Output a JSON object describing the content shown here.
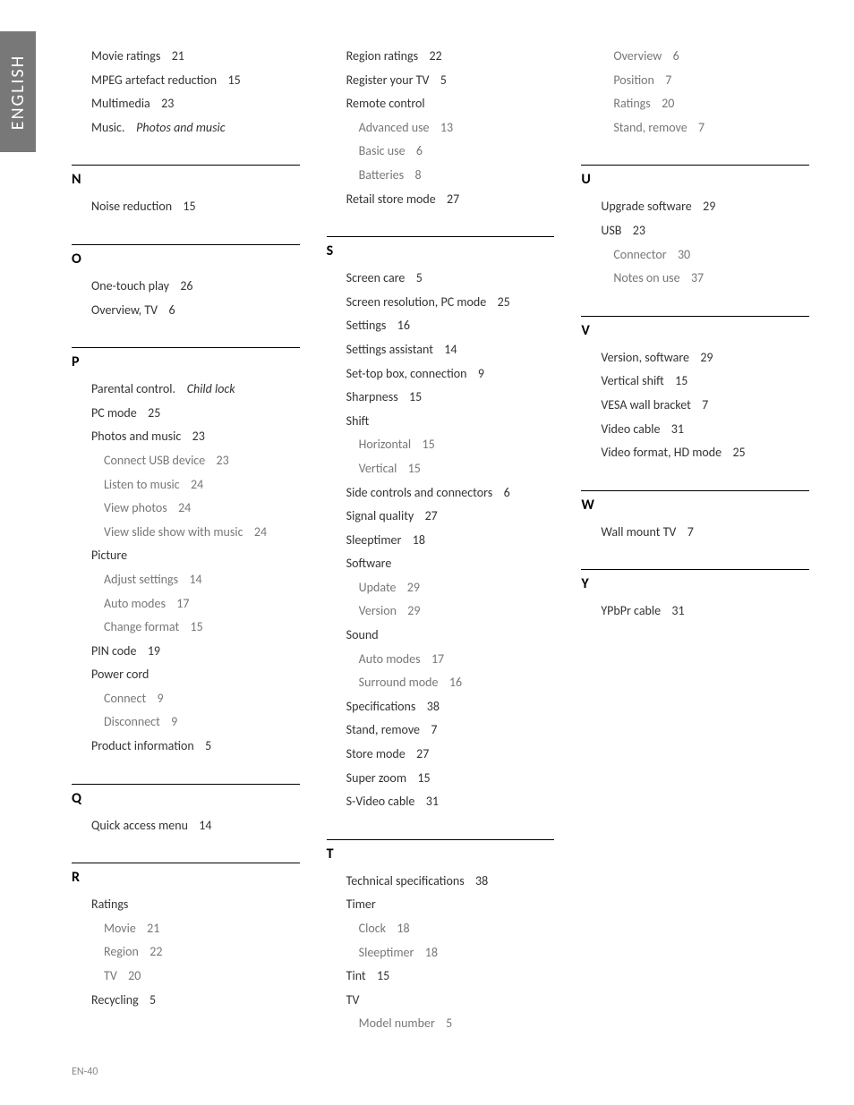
{
  "sideTab": "ENGLISH",
  "pageNumber": "EN-40",
  "columns": [
    [
      {
        "letter": "",
        "noRule": true,
        "entries": [
          {
            "type": "main",
            "label": "Movie ratings",
            "page": "21"
          },
          {
            "type": "main",
            "label": "MPEG artefact reduction",
            "page": "15"
          },
          {
            "type": "main",
            "label": "Multimedia",
            "page": "23"
          },
          {
            "type": "main",
            "label": "Music.",
            "see": "Photos and music"
          }
        ]
      },
      {
        "letter": "N",
        "entries": [
          {
            "type": "main",
            "label": "Noise reduction",
            "page": "15"
          }
        ]
      },
      {
        "letter": "O",
        "entries": [
          {
            "type": "main",
            "label": "One-touch play",
            "page": "26"
          },
          {
            "type": "main",
            "label": "Overview, TV",
            "page": "6"
          }
        ]
      },
      {
        "letter": "P",
        "entries": [
          {
            "type": "main",
            "label": "Parental control.",
            "see": "Child lock"
          },
          {
            "type": "main",
            "label": "PC mode",
            "page": "25"
          },
          {
            "type": "main",
            "label": "Photos and music",
            "page": "23"
          },
          {
            "type": "sub",
            "label": "Connect USB device",
            "page": "23"
          },
          {
            "type": "sub",
            "label": "Listen to music",
            "page": "24"
          },
          {
            "type": "sub",
            "label": "View photos",
            "page": "24"
          },
          {
            "type": "sub",
            "label": "View slide show with music",
            "page": "24"
          },
          {
            "type": "main",
            "label": "Picture"
          },
          {
            "type": "sub",
            "label": "Adjust settings",
            "page": "14"
          },
          {
            "type": "sub",
            "label": "Auto modes",
            "page": "17"
          },
          {
            "type": "sub",
            "label": "Change format",
            "page": "15"
          },
          {
            "type": "main",
            "label": "PIN code",
            "page": "19"
          },
          {
            "type": "main",
            "label": "Power cord"
          },
          {
            "type": "sub",
            "label": "Connect",
            "page": "9"
          },
          {
            "type": "sub",
            "label": "Disconnect",
            "page": "9"
          },
          {
            "type": "main",
            "label": "Product information",
            "page": "5"
          }
        ]
      },
      {
        "letter": "Q",
        "entries": [
          {
            "type": "main",
            "label": "Quick access menu",
            "page": "14"
          }
        ]
      },
      {
        "letter": "R",
        "entries": [
          {
            "type": "main",
            "label": "Ratings"
          },
          {
            "type": "sub",
            "label": "Movie",
            "page": "21"
          },
          {
            "type": "sub",
            "label": "Region",
            "page": "22"
          },
          {
            "type": "sub",
            "label": "TV",
            "page": "20"
          },
          {
            "type": "main",
            "label": "Recycling",
            "page": "5"
          }
        ]
      }
    ],
    [
      {
        "letter": "",
        "noRule": true,
        "entries": [
          {
            "type": "main",
            "label": "Region ratings",
            "page": "22"
          },
          {
            "type": "main",
            "label": "Register your TV",
            "page": "5"
          },
          {
            "type": "main",
            "label": "Remote control"
          },
          {
            "type": "sub",
            "label": "Advanced use",
            "page": "13"
          },
          {
            "type": "sub",
            "label": "Basic use",
            "page": "6"
          },
          {
            "type": "sub",
            "label": "Batteries",
            "page": "8"
          },
          {
            "type": "main",
            "label": "Retail store mode",
            "page": "27"
          }
        ]
      },
      {
        "letter": "S",
        "entries": [
          {
            "type": "main",
            "label": "Screen care",
            "page": "5"
          },
          {
            "type": "main",
            "label": "Screen resolution, PC mode",
            "page": "25"
          },
          {
            "type": "main",
            "label": "Settings",
            "page": "16"
          },
          {
            "type": "main",
            "label": "Settings assistant",
            "page": "14"
          },
          {
            "type": "main",
            "label": "Set-top box, connection",
            "page": "9"
          },
          {
            "type": "main",
            "label": "Sharpness",
            "page": "15"
          },
          {
            "type": "main",
            "label": "Shift"
          },
          {
            "type": "sub",
            "label": "Horizontal",
            "page": "15"
          },
          {
            "type": "sub",
            "label": "Vertical",
            "page": "15"
          },
          {
            "type": "main",
            "label": "Side controls and connectors",
            "page": "6"
          },
          {
            "type": "main",
            "label": "Signal quality",
            "page": "27"
          },
          {
            "type": "main",
            "label": "Sleeptimer",
            "page": "18"
          },
          {
            "type": "main",
            "label": "Software"
          },
          {
            "type": "sub",
            "label": "Update",
            "page": "29"
          },
          {
            "type": "sub",
            "label": "Version",
            "page": "29"
          },
          {
            "type": "main",
            "label": "Sound"
          },
          {
            "type": "sub",
            "label": "Auto modes",
            "page": "17"
          },
          {
            "type": "sub",
            "label": "Surround mode",
            "page": "16"
          },
          {
            "type": "main",
            "label": "Specifications",
            "page": "38"
          },
          {
            "type": "main",
            "label": "Stand, remove",
            "page": "7"
          },
          {
            "type": "main",
            "label": "Store mode",
            "page": "27"
          },
          {
            "type": "main",
            "label": "Super zoom",
            "page": "15"
          },
          {
            "type": "main",
            "label": "S-Video cable",
            "page": "31"
          }
        ]
      },
      {
        "letter": "T",
        "entries": [
          {
            "type": "main",
            "label": "Technical specifications",
            "page": "38"
          },
          {
            "type": "main",
            "label": "Timer"
          },
          {
            "type": "sub",
            "label": "Clock",
            "page": "18"
          },
          {
            "type": "sub",
            "label": "Sleeptimer",
            "page": "18"
          },
          {
            "type": "main",
            "label": "Tint",
            "page": "15"
          },
          {
            "type": "main",
            "label": "TV"
          },
          {
            "type": "sub",
            "label": "Model number",
            "page": "5"
          }
        ]
      }
    ],
    [
      {
        "letter": "",
        "noRule": true,
        "entries": [
          {
            "type": "sub",
            "label": "Overview",
            "page": "6"
          },
          {
            "type": "sub",
            "label": "Position",
            "page": "7"
          },
          {
            "type": "sub",
            "label": "Ratings",
            "page": "20"
          },
          {
            "type": "sub",
            "label": "Stand, remove",
            "page": "7"
          }
        ]
      },
      {
        "letter": "U",
        "entries": [
          {
            "type": "main",
            "label": "Upgrade software",
            "page": "29"
          },
          {
            "type": "main",
            "label": "USB",
            "page": "23"
          },
          {
            "type": "sub",
            "label": "Connector",
            "page": "30"
          },
          {
            "type": "sub",
            "label": "Notes on use",
            "page": "37"
          }
        ]
      },
      {
        "letter": "V",
        "entries": [
          {
            "type": "main",
            "label": "Version, software",
            "page": "29"
          },
          {
            "type": "main",
            "label": "Vertical shift",
            "page": "15"
          },
          {
            "type": "main",
            "label": "VESA wall bracket",
            "page": "7"
          },
          {
            "type": "main",
            "label": "Video cable",
            "page": "31"
          },
          {
            "type": "main",
            "label": "Video format, HD mode",
            "page": "25"
          }
        ]
      },
      {
        "letter": "W",
        "entries": [
          {
            "type": "main",
            "label": "Wall mount TV",
            "page": "7"
          }
        ]
      },
      {
        "letter": "Y",
        "entries": [
          {
            "type": "main",
            "label": "YPbPr cable",
            "page": "31"
          }
        ]
      }
    ]
  ]
}
